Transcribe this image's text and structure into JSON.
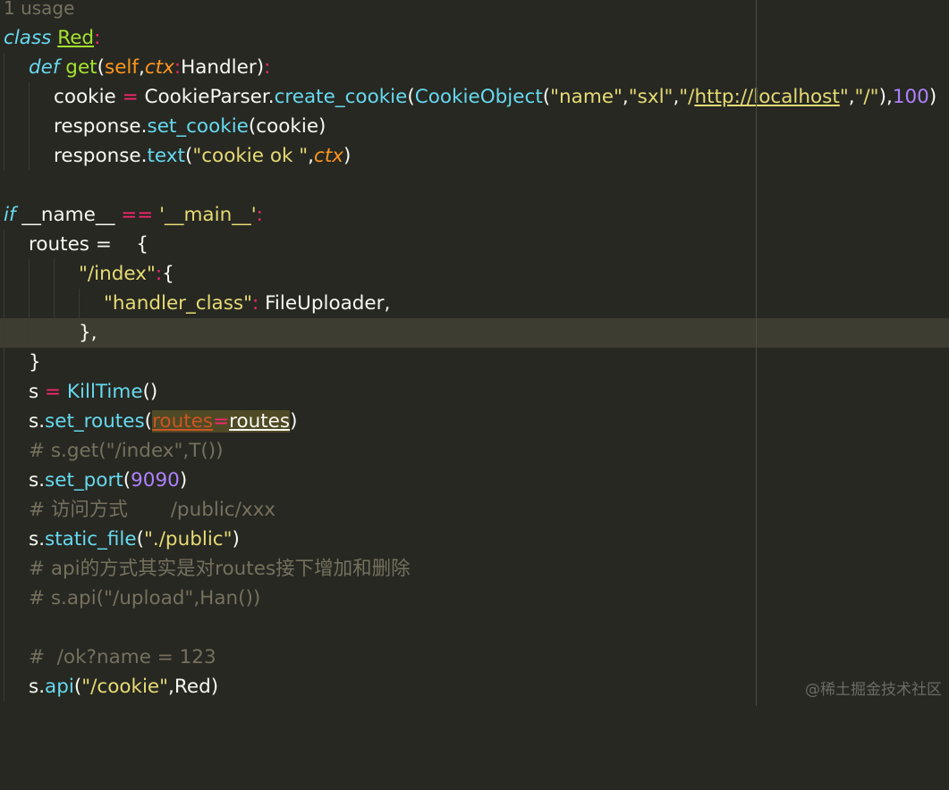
{
  "editor": {
    "usage_hint": "1 usage",
    "l1": {
      "kw": "class",
      "name": "Red",
      "colon": ":"
    },
    "l2": {
      "kw": "def",
      "fn": "get",
      "p1": "(",
      "self": "self",
      "comma": ",",
      "ctx": "ctx",
      "colon": ":",
      "type": "Handler",
      "p2": ")",
      "end": ":"
    },
    "l3": {
      "a": "cookie ",
      "eq": "=",
      "b": " CookieParser.",
      "m1": "create_cookie",
      "c": "(",
      "m2": "CookieObject",
      "d": "(",
      "s1": "\"name\"",
      "e": ",",
      "s2": "\"sxl\"",
      "f": ",",
      "s3a": "\"/",
      "s3link": "http://localhost",
      "s3b": "\"",
      "g": ",",
      "s4": "\"/\"",
      "h": "),",
      "n": "100",
      "i": ")"
    },
    "l4": {
      "a": "response.",
      "m": "set_cookie",
      "b": "(cookie)"
    },
    "l5": {
      "a": "response.",
      "m": "text",
      "b": "(",
      "s": "\"cookie ok \"",
      "c": ",",
      "ctx": "ctx",
      "d": ")"
    },
    "l7": {
      "kw": "if",
      "a": " __name__ ",
      "op": "==",
      "b": " ",
      "s": "'__main__'",
      "c": ":"
    },
    "l8": {
      "a": "routes =    {"
    },
    "l9": {
      "s": "\"/index\"",
      "c": ":",
      "b": "{"
    },
    "l10": {
      "s": "\"handler_class\"",
      "c": ":",
      "b": " FileUploader,"
    },
    "l11": {
      "a": "},"
    },
    "l12": {
      "a": "}"
    },
    "l13": {
      "a": "s ",
      "op": "=",
      "b": " ",
      "m": "KillTime",
      "c": "()"
    },
    "l14": {
      "a": "s.",
      "m": "set_routes",
      "b": "(",
      "k": "routes",
      "op": "=",
      "v": "routes",
      "c": ")"
    },
    "l15": {
      "cmt": "# s.get(\"/index\",T())"
    },
    "l16": {
      "a": "s.",
      "m": "set_port",
      "b": "(",
      "n": "9090",
      "c": ")"
    },
    "l17": {
      "cmt": "# 访问方式       /public/xxx"
    },
    "l18": {
      "a": "s.",
      "m": "static_file",
      "b": "(",
      "s": "\"./public\"",
      "c": ")"
    },
    "l19": {
      "cmt": "# api的方式其实是对routes接下增加和删除"
    },
    "l20": {
      "cmt": "# s.api(\"/upload\",Han())"
    },
    "l22": {
      "cmt": "#  /ok?name = 123"
    },
    "l23": {
      "a": "s.",
      "m": "api",
      "b": "(",
      "s": "\"/cookie\"",
      "c": ",Red)"
    }
  },
  "watermark": "@稀土掘金技术社区",
  "theme": {
    "background": "#272822",
    "current_line": "#3e3d32"
  }
}
